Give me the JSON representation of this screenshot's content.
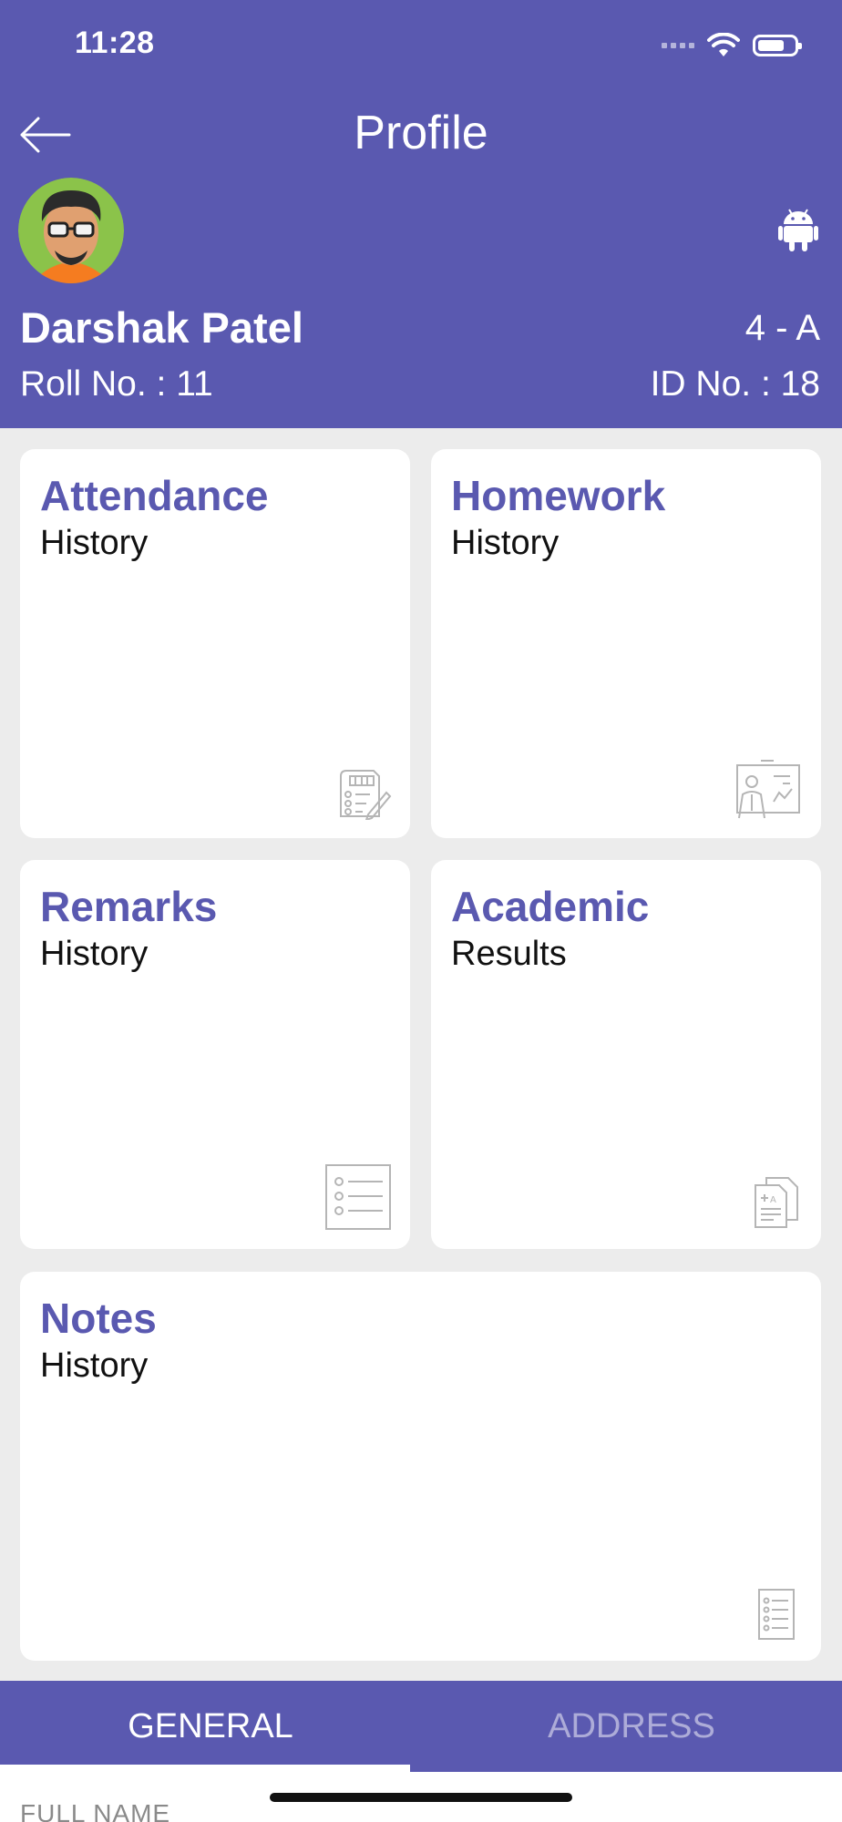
{
  "status_bar": {
    "time": "11:28"
  },
  "header": {
    "title": "Profile",
    "student_name": "Darshak Patel",
    "class_section": "4 - A",
    "roll_no": "Roll No. : 11",
    "id_no": "ID No. : 18"
  },
  "cards": [
    {
      "title": "Attendance",
      "subtitle": "History",
      "icon": "attendance-checklist-icon"
    },
    {
      "title": "Homework",
      "subtitle": "History",
      "icon": "homework-board-icon"
    },
    {
      "title": "Remarks",
      "subtitle": "History",
      "icon": "remarks-list-icon"
    },
    {
      "title": "Academic",
      "subtitle": "Results",
      "icon": "academic-results-icon"
    },
    {
      "title": "Notes",
      "subtitle": "History",
      "icon": "notes-list-icon"
    }
  ],
  "tabs": [
    {
      "label": "GENERAL",
      "active": true
    },
    {
      "label": "ADDRESS",
      "active": false
    }
  ],
  "form": {
    "first_field_label": "FULL NAME"
  },
  "colors": {
    "primary": "#5a59b0",
    "background": "#ececec",
    "card": "#ffffff"
  }
}
